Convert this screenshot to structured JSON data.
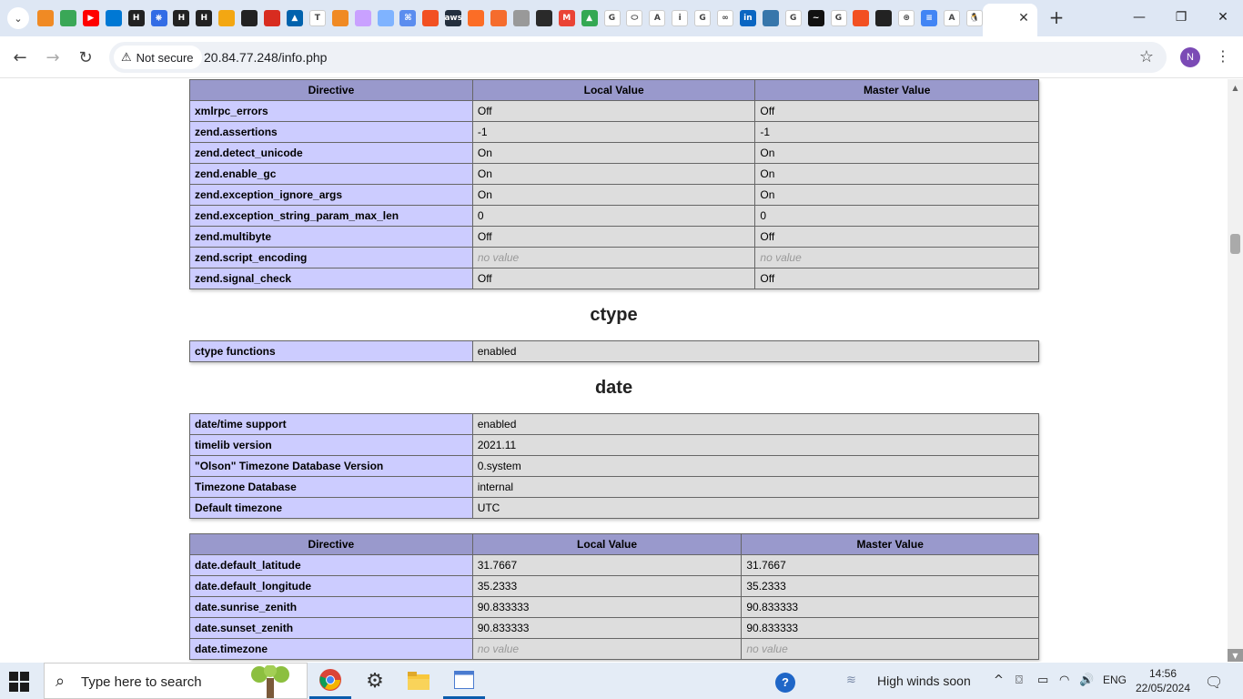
{
  "browser": {
    "tab_title": "",
    "url": "20.84.77.248/info.php",
    "security_label": "Not secure",
    "profile_initial": "N",
    "favicons": [
      {
        "icon": "cube-icon",
        "color": "#f08a24",
        "glyph": ""
      },
      {
        "icon": "cloud-icon",
        "color": "#3aa757",
        "glyph": ""
      },
      {
        "icon": "youtube-icon",
        "color": "#ff0000",
        "glyph": "▶"
      },
      {
        "icon": "azure-devops-icon",
        "color": "#0078d4",
        "glyph": ""
      },
      {
        "icon": "hashicorp-icon",
        "color": "#222",
        "glyph": "H"
      },
      {
        "icon": "kubernetes-icon",
        "color": "#326ce5",
        "glyph": "⎈"
      },
      {
        "icon": "hashicorp-icon",
        "color": "#222",
        "glyph": "H"
      },
      {
        "icon": "hashicorp-icon",
        "color": "#222",
        "glyph": "H"
      },
      {
        "icon": "box-icon",
        "color": "#f3a712",
        "glyph": ""
      },
      {
        "icon": "github-icon",
        "color": "#222",
        "glyph": ""
      },
      {
        "icon": "redis-icon",
        "color": "#d82c20",
        "glyph": ""
      },
      {
        "icon": "azure-icon",
        "color": "#0062ad",
        "glyph": "▲"
      },
      {
        "icon": "t-icon",
        "color": "#fff",
        "glyph": "T"
      },
      {
        "icon": "cube-icon",
        "color": "#f08a24",
        "glyph": ""
      },
      {
        "icon": "cube-outline-icon",
        "color": "#c9a1ff",
        "glyph": ""
      },
      {
        "icon": "cube-outline-icon",
        "color": "#7fb3ff",
        "glyph": ""
      },
      {
        "icon": "grid-icon",
        "color": "#5b8def",
        "glyph": "⌘"
      },
      {
        "icon": "windows-icon",
        "color": "#f25022",
        "glyph": ""
      },
      {
        "icon": "aws-icon",
        "color": "#232f3e",
        "glyph": "aws"
      },
      {
        "icon": "gitlab-icon",
        "color": "#fc6d26",
        "glyph": ""
      },
      {
        "icon": "helm-icon",
        "color": "#f56c2d",
        "glyph": ""
      },
      {
        "icon": "unity-icon",
        "color": "#999",
        "glyph": ""
      },
      {
        "icon": "terraform-icon",
        "color": "#2a2a2a",
        "glyph": ""
      },
      {
        "icon": "gmail-icon",
        "color": "#ea4335",
        "glyph": "M"
      },
      {
        "icon": "drive-icon",
        "color": "#34a853",
        "glyph": "▲"
      },
      {
        "icon": "google-icon",
        "color": "#fff",
        "glyph": "G"
      },
      {
        "icon": "oracle-icon",
        "color": "#fff",
        "glyph": "⬭"
      },
      {
        "icon": "azure-icon",
        "color": "#fff",
        "glyph": "A"
      },
      {
        "icon": "info-icon",
        "color": "#fff",
        "glyph": "i"
      },
      {
        "icon": "google-icon",
        "color": "#fff",
        "glyph": "G"
      },
      {
        "icon": "link-icon",
        "color": "#fff",
        "glyph": "∞"
      },
      {
        "icon": "linkedin-icon",
        "color": "#0a66c2",
        "glyph": "in"
      },
      {
        "icon": "python-icon",
        "color": "#3776ab",
        "glyph": ""
      },
      {
        "icon": "google-icon",
        "color": "#fff",
        "glyph": "G"
      },
      {
        "icon": "monitor-icon",
        "color": "#111",
        "glyph": "~"
      },
      {
        "icon": "google-icon",
        "color": "#fff",
        "glyph": "G"
      },
      {
        "icon": "microsoft-icon",
        "color": "#f25022",
        "glyph": ""
      },
      {
        "icon": "github-icon",
        "color": "#222",
        "glyph": ""
      },
      {
        "icon": "openai-icon",
        "color": "#fff",
        "glyph": "⊛"
      },
      {
        "icon": "docs-icon",
        "color": "#4285f4",
        "glyph": "≡"
      },
      {
        "icon": "azure-icon",
        "color": "#fff",
        "glyph": "A"
      },
      {
        "icon": "penguin-icon",
        "color": "#fff",
        "glyph": "🐧"
      }
    ]
  },
  "tables": {
    "zend": {
      "headers": [
        "Directive",
        "Local Value",
        "Master Value"
      ],
      "rows": [
        [
          "xmlrpc_errors",
          "Off",
          "Off"
        ],
        [
          "zend.assertions",
          "-1",
          "-1"
        ],
        [
          "zend.detect_unicode",
          "On",
          "On"
        ],
        [
          "zend.enable_gc",
          "On",
          "On"
        ],
        [
          "zend.exception_ignore_args",
          "On",
          "On"
        ],
        [
          "zend.exception_string_param_max_len",
          "0",
          "0"
        ],
        [
          "zend.multibyte",
          "Off",
          "Off"
        ],
        [
          "zend.script_encoding",
          "no value",
          "no value"
        ],
        [
          "zend.signal_check",
          "Off",
          "Off"
        ]
      ]
    },
    "ctype_heading": "ctype",
    "ctype": {
      "rows": [
        [
          "ctype functions",
          "enabled"
        ]
      ]
    },
    "date_heading": "date",
    "date_info": {
      "rows": [
        [
          "date/time support",
          "enabled"
        ],
        [
          "timelib version",
          "2021.11"
        ],
        [
          "\"Olson\" Timezone Database Version",
          "0.system"
        ],
        [
          "Timezone Database",
          "internal"
        ],
        [
          "Default timezone",
          "UTC"
        ]
      ]
    },
    "date_directives": {
      "headers": [
        "Directive",
        "Local Value",
        "Master Value"
      ],
      "rows": [
        [
          "date.default_latitude",
          "31.7667",
          "31.7667"
        ],
        [
          "date.default_longitude",
          "35.2333",
          "35.2333"
        ],
        [
          "date.sunrise_zenith",
          "90.833333",
          "90.833333"
        ],
        [
          "date.sunset_zenith",
          "90.833333",
          "90.833333"
        ],
        [
          "date.timezone",
          "no value",
          "no value"
        ]
      ]
    }
  },
  "taskbar": {
    "search_placeholder": "Type here to search",
    "weather": "High winds soon",
    "language": "ENG",
    "time": "14:56",
    "date": "22/05/2024"
  }
}
